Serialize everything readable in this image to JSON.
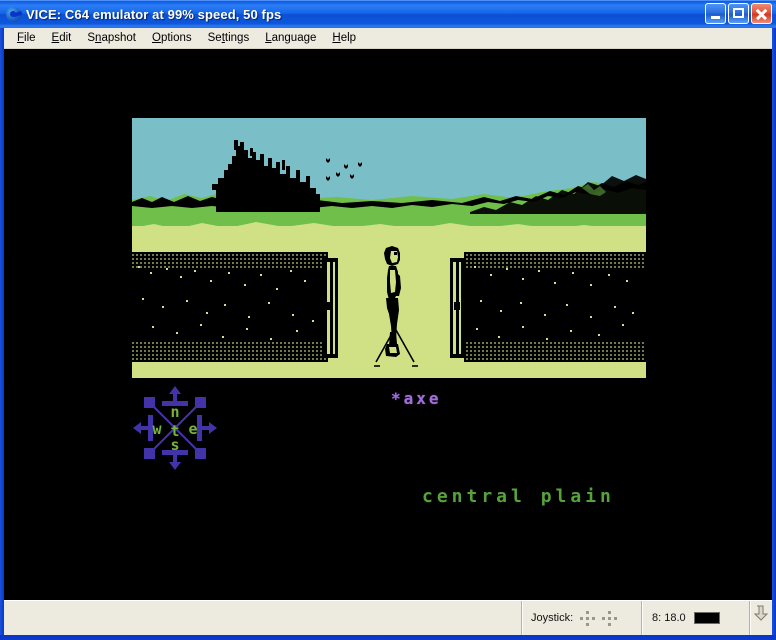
{
  "window": {
    "title": "VICE: C64 emulator at 99% speed, 50 fps",
    "icon": "vice-logo-icon",
    "controls": {
      "minimize": "minimize-button",
      "maximize": "maximize-button",
      "close": "close-button"
    }
  },
  "menubar": {
    "items": [
      {
        "label": "File",
        "accel": "F"
      },
      {
        "label": "Edit",
        "accel": "E"
      },
      {
        "label": "Snapshot",
        "accel": "n"
      },
      {
        "label": "Options",
        "accel": "O"
      },
      {
        "label": "Settings",
        "accel": "t"
      },
      {
        "label": "Language",
        "accel": "L"
      },
      {
        "label": "Help",
        "accel": "H"
      }
    ]
  },
  "game": {
    "item_text": "*axe",
    "location_text": "central plain",
    "compass": {
      "north": "n",
      "west": "w",
      "east": "e",
      "south": "s",
      "center": "t"
    },
    "colors": {
      "background": "#000000",
      "sky": "#7ABFC7",
      "hills": "#6FBF4A",
      "plain": "#CFE184",
      "silhouette": "#000000",
      "item_text": "#9F6FD8",
      "location_text": "#55A33B",
      "compass_arrows": "#4233A8",
      "compass_letters": "#74B43C"
    }
  },
  "statusbar": {
    "main": "",
    "joystick_label": "Joystick:",
    "drive_label": "8: 18.0",
    "drive_led_color": "#000000"
  }
}
